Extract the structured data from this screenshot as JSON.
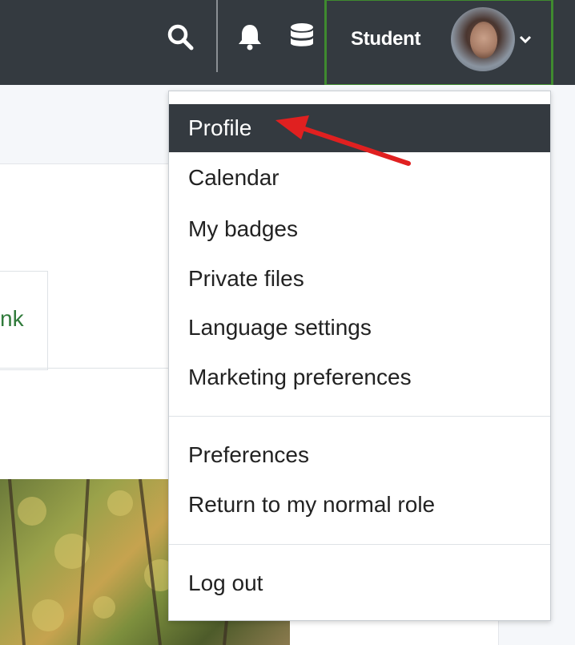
{
  "navbar": {
    "user_name": "Student",
    "icons": [
      "search-icon",
      "bell-icon",
      "database-icon",
      "chevron-down-icon"
    ]
  },
  "background": {
    "link_fragment": "nk"
  },
  "user_menu": {
    "items": [
      {
        "label": "Profile",
        "active": true
      },
      {
        "label": "Calendar"
      },
      {
        "label": "My badges"
      },
      {
        "label": "Private files"
      },
      {
        "label": "Language settings"
      },
      {
        "label": "Marketing preferences"
      },
      {
        "label": "Preferences"
      },
      {
        "label": "Return to my normal role"
      },
      {
        "label": "Log out"
      }
    ]
  },
  "colors": {
    "navbar_bg": "#343a40",
    "highlight_border": "#3f8a2f",
    "annotation_arrow": "#e02020",
    "link_green": "#2f7a3a"
  }
}
